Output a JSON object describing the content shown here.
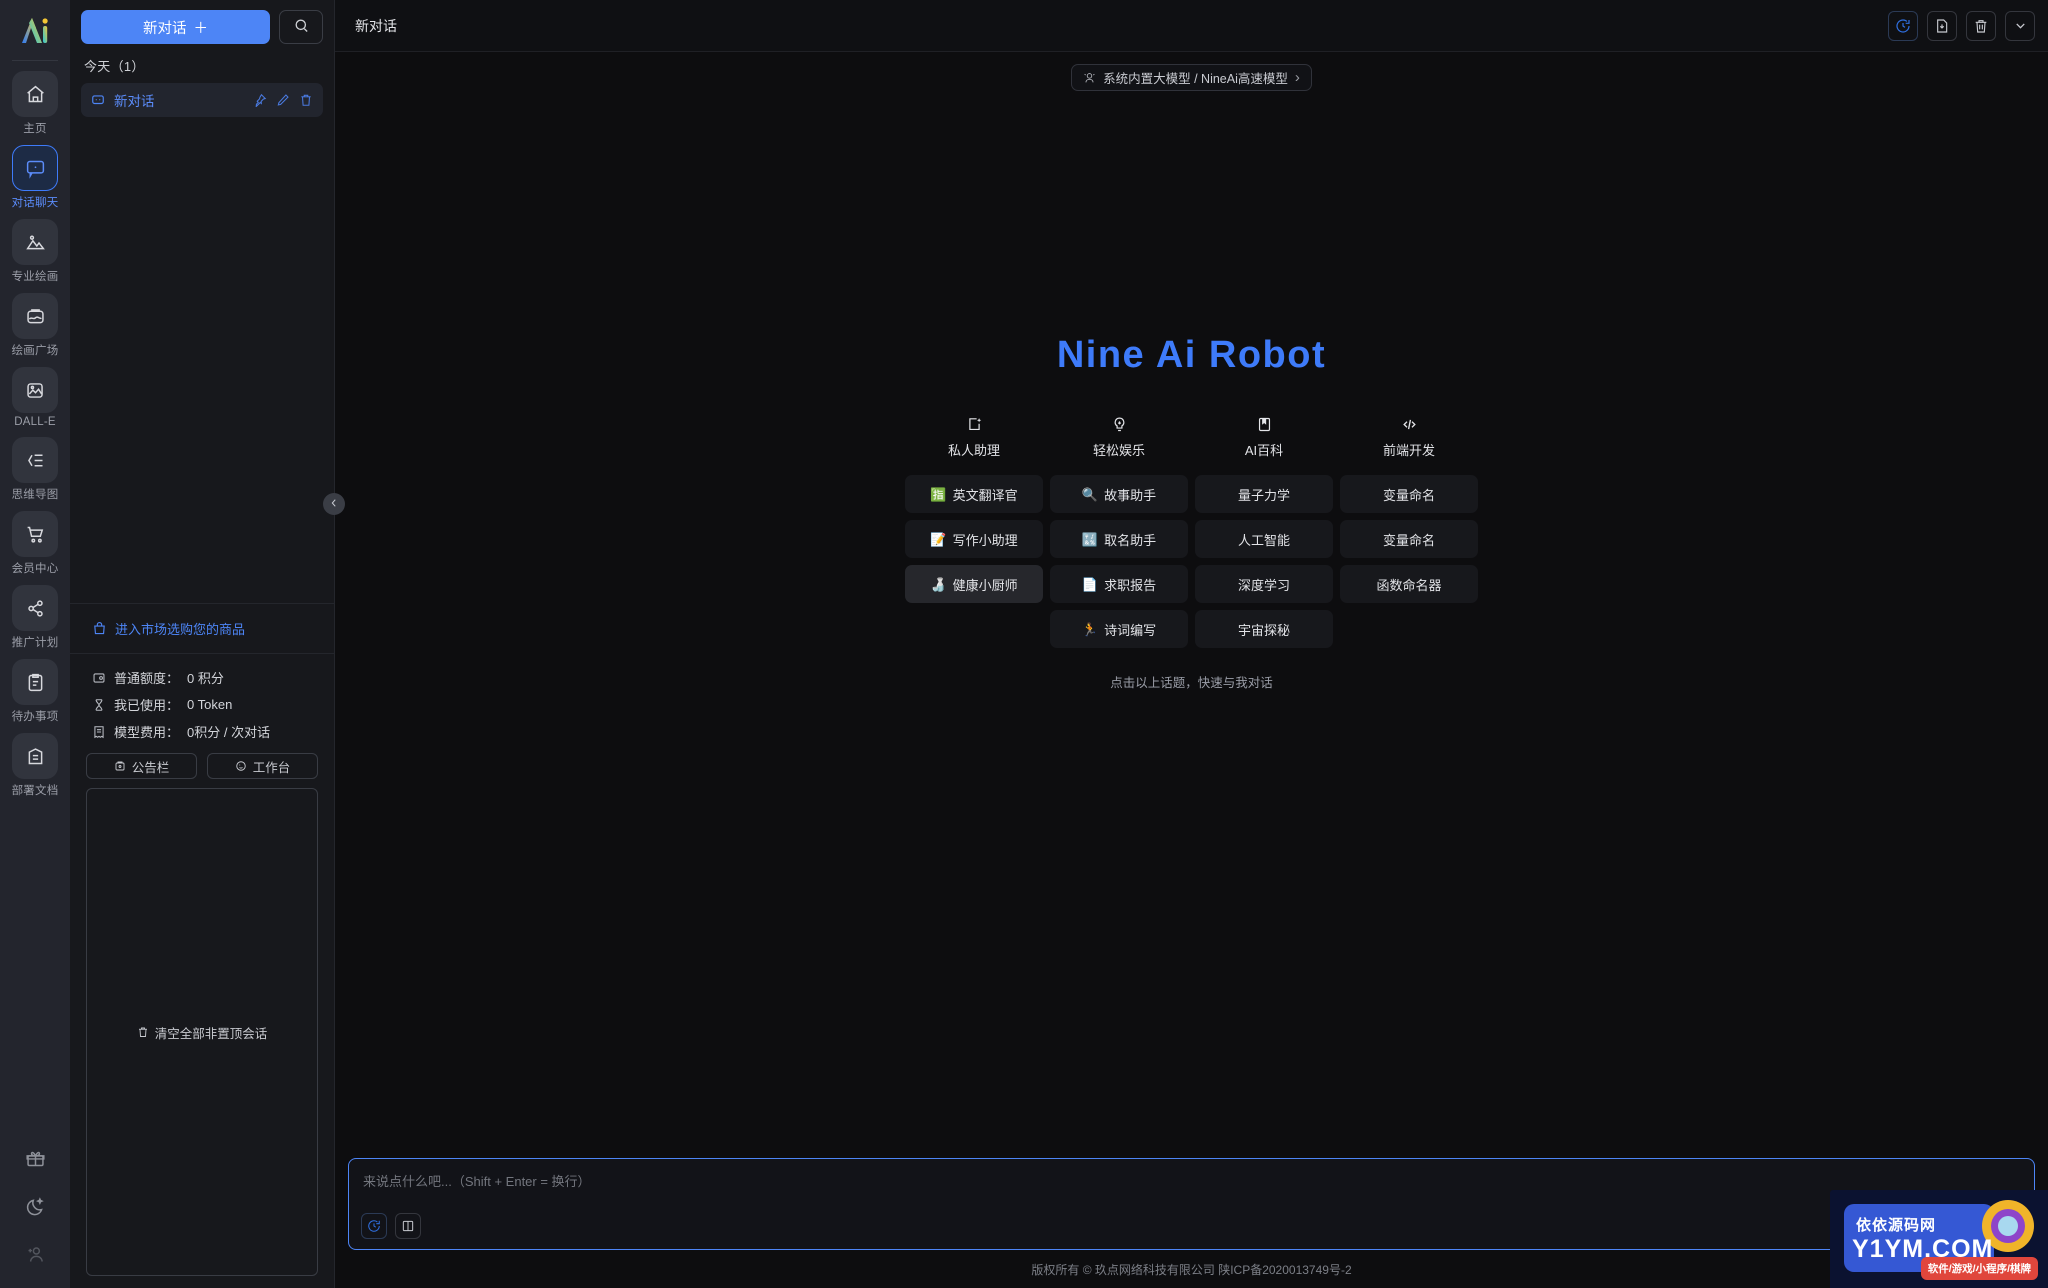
{
  "rail": {
    "logo_name": "ai-logo",
    "items": [
      {
        "label": "主页",
        "icon": "home-icon",
        "active": false
      },
      {
        "label": "对话聊天",
        "icon": "chat-icon",
        "active": true
      },
      {
        "label": "专业绘画",
        "icon": "image-icon",
        "active": false
      },
      {
        "label": "绘画广场",
        "icon": "gallery-icon",
        "active": false
      },
      {
        "label": "DALL-E",
        "icon": "photo-edit-icon",
        "active": false
      },
      {
        "label": "思维导图",
        "icon": "mindmap-icon",
        "active": false
      },
      {
        "label": "会员中心",
        "icon": "cart-icon",
        "active": false
      },
      {
        "label": "推广计划",
        "icon": "share-icon",
        "active": false
      },
      {
        "label": "待办事项",
        "icon": "clipboard-icon",
        "active": false
      },
      {
        "label": "部署文档",
        "icon": "doc-icon",
        "active": false
      }
    ],
    "bottom_icons": [
      {
        "name": "gift-icon"
      },
      {
        "name": "moon-icon"
      },
      {
        "name": "add-user-icon"
      }
    ]
  },
  "sidebar": {
    "new_chat_label": "新对话",
    "new_chat_plus": "＋",
    "search_icon": "search-icon",
    "group_title": "今天（1）",
    "conversations": [
      {
        "title": "新对话",
        "icon": "chat-bubble-icon",
        "actions": [
          "pin-icon",
          "edit-icon",
          "delete-icon"
        ]
      }
    ],
    "market_link": "进入市场选购您的商品",
    "market_icon": "shop-icon",
    "stats": [
      {
        "icon": "credit-icon",
        "label": "普通额度：",
        "value": "0 积分"
      },
      {
        "icon": "hourglass-icon",
        "label": "我已使用：",
        "value": "0 Token"
      },
      {
        "icon": "receipt-icon",
        "label": "模型费用：",
        "value": "0积分 / 次对话"
      }
    ],
    "buttons": [
      {
        "label": "公告栏",
        "icon": "megaphone-icon"
      },
      {
        "label": "工作台",
        "icon": "workbench-icon"
      }
    ],
    "clear_button": {
      "label": "清空全部非置顶会话",
      "icon": "trash-icon"
    },
    "collapse_icon": "chevron-left-icon"
  },
  "header": {
    "title": "新对话",
    "buttons": [
      {
        "name": "history-icon",
        "accent": true
      },
      {
        "name": "save-file-icon",
        "accent": false
      },
      {
        "name": "delete-icon",
        "accent": false
      },
      {
        "name": "chevron-down-icon",
        "accent": false
      }
    ]
  },
  "model": {
    "icon": "model-icon",
    "label": "系统内置大模型 / NineAi高速模型",
    "chevron": "›"
  },
  "main": {
    "brand": "Nine Ai Robot",
    "categories": [
      {
        "label": "私人助理",
        "icon": "assistant-icon"
      },
      {
        "label": "轻松娱乐",
        "icon": "bulb-icon"
      },
      {
        "label": "AI百科",
        "icon": "book-icon"
      },
      {
        "label": "前端开发",
        "icon": "code-icon"
      }
    ],
    "topics": [
      {
        "label": "英文翻译官",
        "emoji": "🈯",
        "highlight": false
      },
      {
        "label": "故事助手",
        "emoji": "🔍",
        "highlight": false
      },
      {
        "label": "量子力学",
        "emoji": "",
        "highlight": false
      },
      {
        "label": "变量命名",
        "emoji": "",
        "highlight": false
      },
      {
        "label": "写作小助理",
        "emoji": "📝",
        "highlight": false
      },
      {
        "label": "取名助手",
        "emoji": "🔣",
        "highlight": false
      },
      {
        "label": "人工智能",
        "emoji": "",
        "highlight": false
      },
      {
        "label": "变量命名",
        "emoji": "",
        "highlight": false
      },
      {
        "label": "健康小厨师",
        "emoji": "🍶",
        "highlight": true
      },
      {
        "label": "求职报告",
        "emoji": "📄",
        "highlight": false
      },
      {
        "label": "深度学习",
        "emoji": "",
        "highlight": false
      },
      {
        "label": "函数命名器",
        "emoji": "",
        "highlight": false
      },
      {
        "label": "",
        "emoji": "",
        "highlight": false,
        "empty": true
      },
      {
        "label": "诗词编写",
        "emoji": "🏃",
        "highlight": false
      },
      {
        "label": "宇宙探秘",
        "emoji": "",
        "highlight": false
      },
      {
        "label": "",
        "emoji": "",
        "highlight": false,
        "empty": true
      }
    ],
    "hint": "点击以上话题，快速与我对话"
  },
  "composer": {
    "placeholder": "来说点什么吧...（Shift + Enter = 换行）",
    "value": "",
    "tools": [
      {
        "name": "history-icon",
        "accent": true
      },
      {
        "name": "panel-icon",
        "accent": false
      }
    ]
  },
  "footer": {
    "copyright": "版权所有 © 玖点网络科技有限公司  陕ICP备2020013749号-2"
  },
  "watermark": {
    "cn_text": "依依源码网",
    "domain": "Y1YM.COM",
    "tags": "软件/游戏/小程序/棋牌"
  },
  "colors": {
    "accent": "#4d85f6",
    "brand": "#3e7bfa",
    "bg": "#0d0d0f",
    "sidebar_bg": "#17181c",
    "rail_bg": "#23252d"
  }
}
